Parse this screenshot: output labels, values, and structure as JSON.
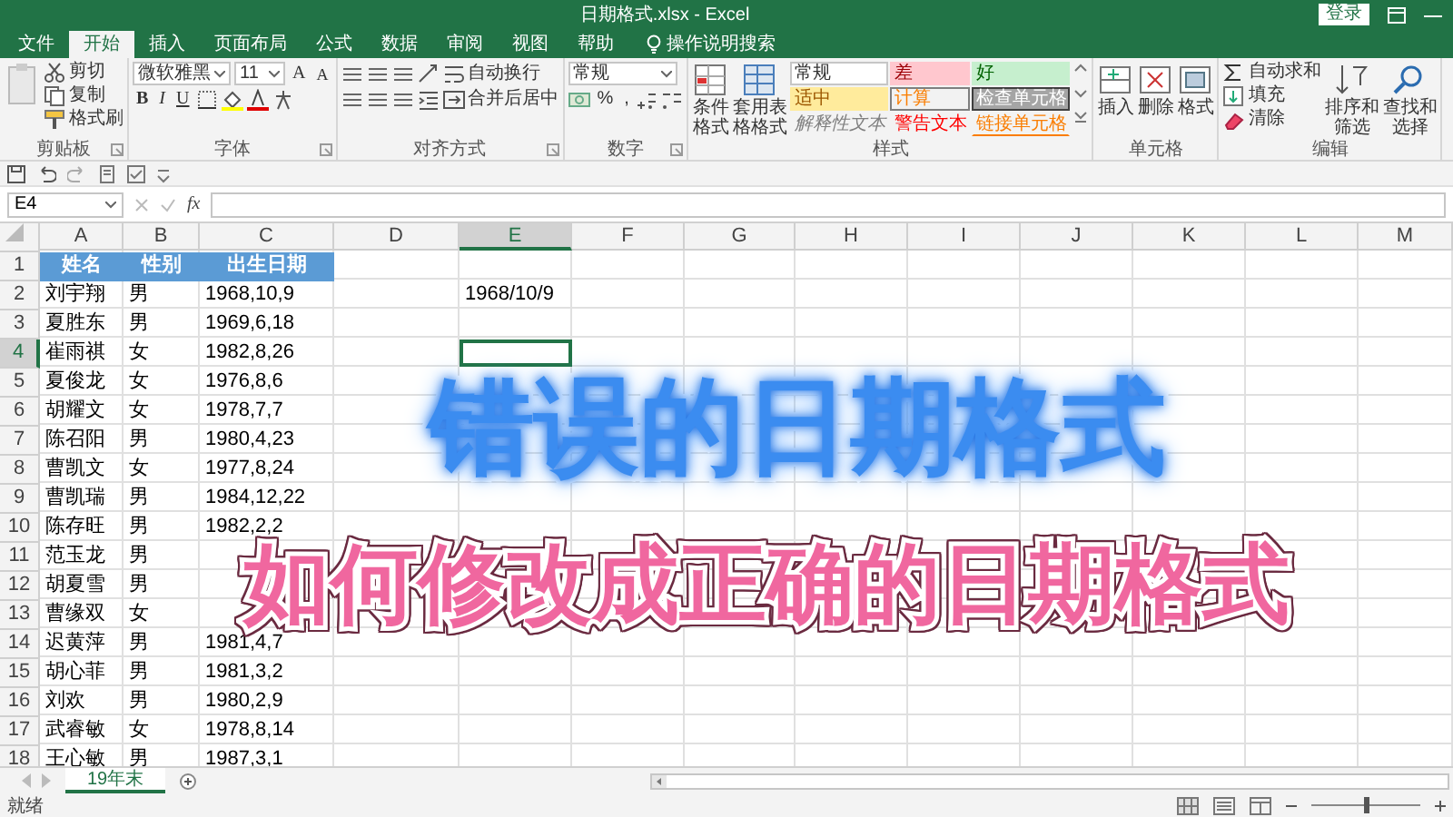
{
  "window": {
    "title": "日期格式.xlsx - Excel",
    "sign_in": "登录"
  },
  "ribbon_tabs": [
    {
      "label": "文件",
      "selected": false
    },
    {
      "label": "开始",
      "selected": true
    },
    {
      "label": "插入",
      "selected": false
    },
    {
      "label": "页面布局",
      "selected": false
    },
    {
      "label": "公式",
      "selected": false
    },
    {
      "label": "数据",
      "selected": false
    },
    {
      "label": "审阅",
      "selected": false
    },
    {
      "label": "视图",
      "selected": false
    },
    {
      "label": "帮助",
      "selected": false
    }
  ],
  "tell_me": {
    "placeholder": "操作说明搜索"
  },
  "ribbon": {
    "groups": [
      {
        "kind": "clipboard",
        "label": "剪贴板",
        "commands": [
          "剪切",
          "复制",
          "格式刷"
        ]
      },
      {
        "kind": "font",
        "label": "字体",
        "font_name": "微软雅黑",
        "font_size": "11",
        "grow_shrink": [
          "A",
          "A"
        ],
        "styles": [
          "B",
          "I",
          "U"
        ]
      },
      {
        "kind": "alignment",
        "label": "对齐方式",
        "commands": [
          "自动换行",
          "合并后居中"
        ]
      },
      {
        "kind": "number",
        "label": "数字",
        "format": "常规",
        "symbols": [
          "%",
          ","
        ]
      },
      {
        "kind": "styles",
        "label": "样式",
        "commands": [
          "条件格式",
          "套用表格格式"
        ],
        "gallery": [
          {
            "kind": "normal",
            "label": "常规"
          },
          {
            "kind": "bad",
            "label": "差"
          },
          {
            "kind": "good",
            "label": "好"
          },
          {
            "kind": "neutral",
            "label": "适中"
          },
          {
            "kind": "calc",
            "label": "计算"
          },
          {
            "kind": "check",
            "label": "检查单元格"
          },
          {
            "kind": "explanatory",
            "label": "解释性文本"
          },
          {
            "kind": "warning",
            "label": "警告文本"
          },
          {
            "kind": "linked",
            "label": "链接单元格"
          }
        ]
      },
      {
        "kind": "cells",
        "label": "单元格",
        "commands": [
          "插入",
          "删除",
          "格式"
        ]
      },
      {
        "kind": "editing",
        "label": "编辑",
        "commands": [
          "自动求和",
          "填充",
          "清除"
        ],
        "big_commands": [
          "排序和筛选",
          "查找和选择"
        ]
      }
    ]
  },
  "formula_bar": {
    "name_box": "E4",
    "function_label": "fx"
  },
  "sheet": {
    "columns": [
      {
        "label": "A",
        "selected": false
      },
      {
        "label": "B",
        "selected": false
      },
      {
        "label": "C",
        "selected": false
      },
      {
        "label": "D",
        "selected": false
      },
      {
        "label": "E",
        "selected": true
      },
      {
        "label": "F",
        "selected": false
      },
      {
        "label": "G",
        "selected": false
      },
      {
        "label": "H",
        "selected": false
      },
      {
        "label": "I",
        "selected": false
      },
      {
        "label": "J",
        "selected": false
      },
      {
        "label": "K",
        "selected": false
      },
      {
        "label": "L",
        "selected": false
      },
      {
        "label": "M",
        "selected": false
      }
    ],
    "rows": [
      {
        "number": "1",
        "selected": false,
        "kind": "header",
        "name": "姓名",
        "gender": "性别",
        "birth_date": "出生日期"
      },
      {
        "number": "2",
        "selected": false,
        "kind": "data",
        "name": "刘宇翔",
        "gender": "男",
        "birth_date": "1968,10,9",
        "column_e": "1968/10/9"
      },
      {
        "number": "3",
        "selected": false,
        "kind": "data",
        "name": "夏胜东",
        "gender": "男",
        "birth_date": "1969,6,18"
      },
      {
        "number": "4",
        "selected": true,
        "kind": "data",
        "name": "崔雨祺",
        "gender": "女",
        "birth_date": "1982,8,26"
      },
      {
        "number": "5",
        "selected": false,
        "kind": "data",
        "name": "夏俊龙",
        "gender": "女",
        "birth_date": "1976,8,6"
      },
      {
        "number": "6",
        "selected": false,
        "kind": "data",
        "name": "胡耀文",
        "gender": "女",
        "birth_date": "1978,7,7"
      },
      {
        "number": "7",
        "selected": false,
        "kind": "data",
        "name": "陈召阳",
        "gender": "男",
        "birth_date": "1980,4,23"
      },
      {
        "number": "8",
        "selected": false,
        "kind": "data",
        "name": "曹凯文",
        "gender": "女",
        "birth_date": "1977,8,24"
      },
      {
        "number": "9",
        "selected": false,
        "kind": "data",
        "name": "曹凯瑞",
        "gender": "男",
        "birth_date": "1984,12,22"
      },
      {
        "number": "10",
        "selected": false,
        "kind": "data",
        "name": "陈存旺",
        "gender": "男",
        "birth_date": "1982,2,2"
      },
      {
        "number": "11",
        "selected": false,
        "kind": "data",
        "name": "范玉龙",
        "gender": "男"
      },
      {
        "number": "12",
        "selected": false,
        "kind": "data",
        "name": "胡夏雪",
        "gender": "男"
      },
      {
        "number": "13",
        "selected": false,
        "kind": "data",
        "name": "曹缘双",
        "gender": "女"
      },
      {
        "number": "14",
        "selected": false,
        "kind": "data",
        "name": "迟黄萍",
        "gender": "男",
        "birth_date": "1981,4,7"
      },
      {
        "number": "15",
        "selected": false,
        "kind": "data",
        "name": "胡心菲",
        "gender": "男",
        "birth_date": "1981,3,2"
      },
      {
        "number": "16",
        "selected": false,
        "kind": "data",
        "name": "刘欢",
        "gender": "男",
        "birth_date": "1980,2,9"
      },
      {
        "number": "17",
        "selected": false,
        "kind": "data",
        "name": "武睿敏",
        "gender": "女",
        "birth_date": "1978,8,14"
      },
      {
        "number": "18",
        "selected": false,
        "kind": "data",
        "name": "王心敏",
        "gender": "男",
        "birth_date": "1987,3,1"
      }
    ]
  },
  "captions": [
    {
      "kind": "blue",
      "text": "错误的日期格式"
    },
    {
      "kind": "pink",
      "text": "如何修改成正确的日期格式"
    }
  ],
  "sheet_tabs": [
    {
      "label": "19年末",
      "selected": true
    }
  ],
  "status_bar": {
    "status": "就绪",
    "zoom": {
      "level": 0.5
    }
  }
}
